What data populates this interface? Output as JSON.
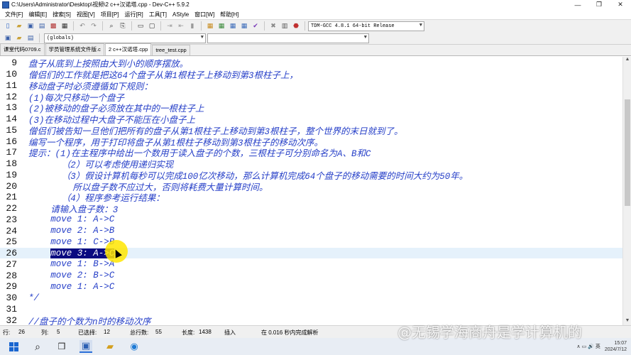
{
  "window": {
    "title": "C:\\Users\\Administrator\\Desktop\\视频\\2 c++汉诺塔.cpp - Dev-C++ 5.9.2",
    "min_glyph": "—",
    "max_glyph": "❐",
    "close_glyph": "✕"
  },
  "menu": [
    "文件[F]",
    "编辑[E]",
    "搜索[S]",
    "视图[V]",
    "项目[P]",
    "运行[R]",
    "工具[T]",
    "AStyle",
    "窗口[W]",
    "帮助[H]"
  ],
  "toolbar": {
    "compiler_select": "TDM-GCC 4.8.1 64-bit Release",
    "scope_select": "(globals)"
  },
  "tabs": [
    {
      "label": "课堂代码0709.c",
      "active": false
    },
    {
      "label": "学员管理系统文件版.c",
      "active": false
    },
    {
      "label": "2 c++汉诺塔.cpp",
      "active": true
    },
    {
      "label": "tree_test.cpp",
      "active": false
    }
  ],
  "editor": {
    "lines": [
      {
        "n": "9",
        "indent": 0,
        "text": "盘子从底到上按照由大到小的顺序摆放。"
      },
      {
        "n": "10",
        "indent": 0,
        "text": "僧侣们的工作就是把这64个盘子从第1根柱子上移动到第3根柱子上，"
      },
      {
        "n": "11",
        "indent": 0,
        "text": "移动盘子时必须遵循如下规则："
      },
      {
        "n": "12",
        "indent": 0,
        "text": "(1)每次只移动一个盘子"
      },
      {
        "n": "13",
        "indent": 0,
        "text": "(2)被移动的盘子必须放在其中的一根柱子上"
      },
      {
        "n": "14",
        "indent": 0,
        "text": "(3)在移动过程中大盘子不能压在小盘子上"
      },
      {
        "n": "15",
        "indent": 0,
        "text": "僧侣们被告知一旦他们把所有的盘子从第1根柱子上移动到第3根柱子，整个世界的末日就到了。"
      },
      {
        "n": "16",
        "indent": 0,
        "text": "编写一个程序，用于打印将盘子从第1根柱子移动到第3根柱子的移动次序。"
      },
      {
        "n": "17",
        "indent": 0,
        "text": "提示：(1)在主程序中给出一个数用于读入盘子的个数，三根柱子可分别命名为A、B和C"
      },
      {
        "n": "18",
        "indent": 3,
        "text": "（2）可以考虑使用递归实现"
      },
      {
        "n": "19",
        "indent": 3,
        "text": "（3）假设计算机每秒可以完成100亿次移动，那么计算机完成64个盘子的移动需要的时间大约为50年。"
      },
      {
        "n": "20",
        "indent": 4,
        "text": "所以盘子数不应过大，否则将耗费大量计算时间。"
      },
      {
        "n": "21",
        "indent": 3,
        "text": "（4）程序参考运行结果："
      },
      {
        "n": "22",
        "indent": 2,
        "text": "请输入盘子数：3"
      },
      {
        "n": "23",
        "indent": 2,
        "text": "move 1: A->C"
      },
      {
        "n": "24",
        "indent": 2,
        "text": "move 2: A->B"
      },
      {
        "n": "25",
        "indent": 2,
        "text": "move 1: C->B"
      },
      {
        "n": "26",
        "indent": 2,
        "text": "move 3: A->C",
        "selected": true
      },
      {
        "n": "27",
        "indent": 2,
        "text": "move 1: B->A"
      },
      {
        "n": "28",
        "indent": 2,
        "text": "move 2: B->C"
      },
      {
        "n": "29",
        "indent": 2,
        "text": "move 1: A->C"
      },
      {
        "n": "30",
        "indent": 0,
        "text": "*/"
      },
      {
        "n": "31",
        "indent": 0,
        "text": ""
      },
      {
        "n": "32",
        "indent": 0,
        "text": "//盘子的个数为n时的移动次序"
      }
    ]
  },
  "status": {
    "row_label": "行:",
    "row_value": "26",
    "col_label": "列:",
    "col_value": "5",
    "sel_label": "已选择:",
    "sel_value": "12",
    "total_label": "总行数:",
    "total_value": "55",
    "len_label": "长度:",
    "len_value": "1438",
    "mode": "插入",
    "parse": "在 0.016 秒内完成解析"
  },
  "taskbar": {
    "time": "15:07",
    "date": "2024/7/12",
    "tray_icons": "∧  ▭  🔊  英"
  },
  "watermark": "@无锡学海商舟是学计算机的"
}
